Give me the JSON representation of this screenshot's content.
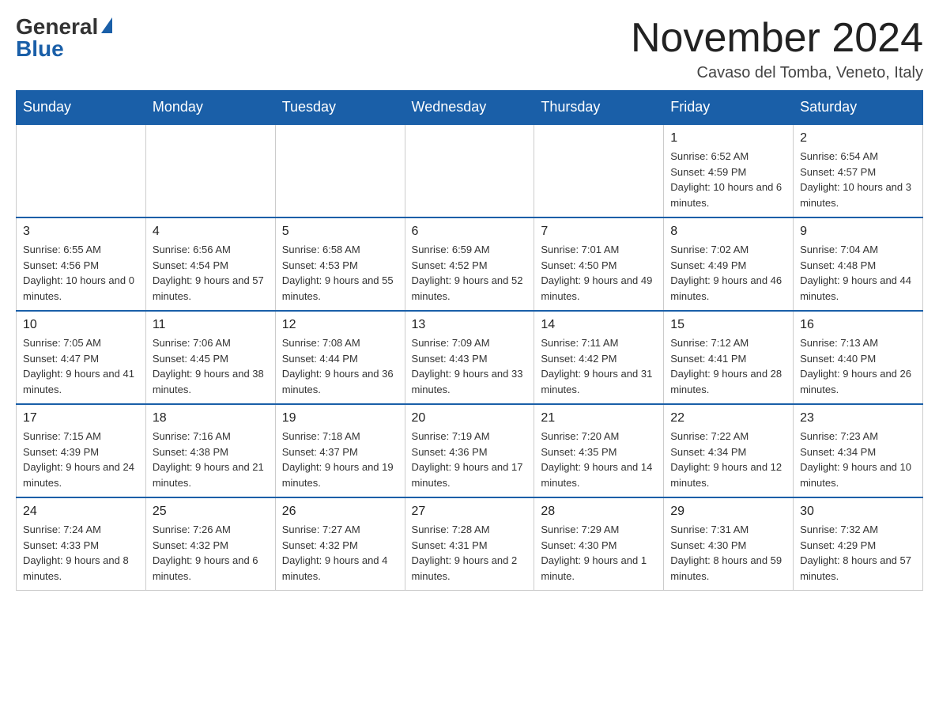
{
  "logo": {
    "general": "General",
    "blue": "Blue"
  },
  "title": "November 2024",
  "location": "Cavaso del Tomba, Veneto, Italy",
  "weekdays": [
    "Sunday",
    "Monday",
    "Tuesday",
    "Wednesday",
    "Thursday",
    "Friday",
    "Saturday"
  ],
  "weeks": [
    [
      {
        "day": "",
        "info": ""
      },
      {
        "day": "",
        "info": ""
      },
      {
        "day": "",
        "info": ""
      },
      {
        "day": "",
        "info": ""
      },
      {
        "day": "",
        "info": ""
      },
      {
        "day": "1",
        "info": "Sunrise: 6:52 AM\nSunset: 4:59 PM\nDaylight: 10 hours and 6 minutes."
      },
      {
        "day": "2",
        "info": "Sunrise: 6:54 AM\nSunset: 4:57 PM\nDaylight: 10 hours and 3 minutes."
      }
    ],
    [
      {
        "day": "3",
        "info": "Sunrise: 6:55 AM\nSunset: 4:56 PM\nDaylight: 10 hours and 0 minutes."
      },
      {
        "day": "4",
        "info": "Sunrise: 6:56 AM\nSunset: 4:54 PM\nDaylight: 9 hours and 57 minutes."
      },
      {
        "day": "5",
        "info": "Sunrise: 6:58 AM\nSunset: 4:53 PM\nDaylight: 9 hours and 55 minutes."
      },
      {
        "day": "6",
        "info": "Sunrise: 6:59 AM\nSunset: 4:52 PM\nDaylight: 9 hours and 52 minutes."
      },
      {
        "day": "7",
        "info": "Sunrise: 7:01 AM\nSunset: 4:50 PM\nDaylight: 9 hours and 49 minutes."
      },
      {
        "day": "8",
        "info": "Sunrise: 7:02 AM\nSunset: 4:49 PM\nDaylight: 9 hours and 46 minutes."
      },
      {
        "day": "9",
        "info": "Sunrise: 7:04 AM\nSunset: 4:48 PM\nDaylight: 9 hours and 44 minutes."
      }
    ],
    [
      {
        "day": "10",
        "info": "Sunrise: 7:05 AM\nSunset: 4:47 PM\nDaylight: 9 hours and 41 minutes."
      },
      {
        "day": "11",
        "info": "Sunrise: 7:06 AM\nSunset: 4:45 PM\nDaylight: 9 hours and 38 minutes."
      },
      {
        "day": "12",
        "info": "Sunrise: 7:08 AM\nSunset: 4:44 PM\nDaylight: 9 hours and 36 minutes."
      },
      {
        "day": "13",
        "info": "Sunrise: 7:09 AM\nSunset: 4:43 PM\nDaylight: 9 hours and 33 minutes."
      },
      {
        "day": "14",
        "info": "Sunrise: 7:11 AM\nSunset: 4:42 PM\nDaylight: 9 hours and 31 minutes."
      },
      {
        "day": "15",
        "info": "Sunrise: 7:12 AM\nSunset: 4:41 PM\nDaylight: 9 hours and 28 minutes."
      },
      {
        "day": "16",
        "info": "Sunrise: 7:13 AM\nSunset: 4:40 PM\nDaylight: 9 hours and 26 minutes."
      }
    ],
    [
      {
        "day": "17",
        "info": "Sunrise: 7:15 AM\nSunset: 4:39 PM\nDaylight: 9 hours and 24 minutes."
      },
      {
        "day": "18",
        "info": "Sunrise: 7:16 AM\nSunset: 4:38 PM\nDaylight: 9 hours and 21 minutes."
      },
      {
        "day": "19",
        "info": "Sunrise: 7:18 AM\nSunset: 4:37 PM\nDaylight: 9 hours and 19 minutes."
      },
      {
        "day": "20",
        "info": "Sunrise: 7:19 AM\nSunset: 4:36 PM\nDaylight: 9 hours and 17 minutes."
      },
      {
        "day": "21",
        "info": "Sunrise: 7:20 AM\nSunset: 4:35 PM\nDaylight: 9 hours and 14 minutes."
      },
      {
        "day": "22",
        "info": "Sunrise: 7:22 AM\nSunset: 4:34 PM\nDaylight: 9 hours and 12 minutes."
      },
      {
        "day": "23",
        "info": "Sunrise: 7:23 AM\nSunset: 4:34 PM\nDaylight: 9 hours and 10 minutes."
      }
    ],
    [
      {
        "day": "24",
        "info": "Sunrise: 7:24 AM\nSunset: 4:33 PM\nDaylight: 9 hours and 8 minutes."
      },
      {
        "day": "25",
        "info": "Sunrise: 7:26 AM\nSunset: 4:32 PM\nDaylight: 9 hours and 6 minutes."
      },
      {
        "day": "26",
        "info": "Sunrise: 7:27 AM\nSunset: 4:32 PM\nDaylight: 9 hours and 4 minutes."
      },
      {
        "day": "27",
        "info": "Sunrise: 7:28 AM\nSunset: 4:31 PM\nDaylight: 9 hours and 2 minutes."
      },
      {
        "day": "28",
        "info": "Sunrise: 7:29 AM\nSunset: 4:30 PM\nDaylight: 9 hours and 1 minute."
      },
      {
        "day": "29",
        "info": "Sunrise: 7:31 AM\nSunset: 4:30 PM\nDaylight: 8 hours and 59 minutes."
      },
      {
        "day": "30",
        "info": "Sunrise: 7:32 AM\nSunset: 4:29 PM\nDaylight: 8 hours and 57 minutes."
      }
    ]
  ]
}
